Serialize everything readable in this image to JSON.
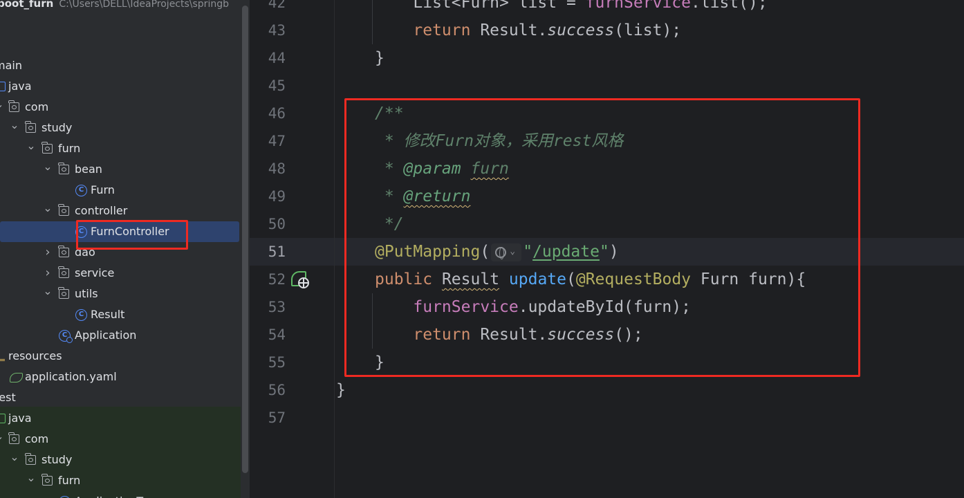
{
  "project": {
    "name": "boot_furn",
    "path": "C:\\Users\\DELL\\IdeaProjects\\springb"
  },
  "tree": [
    {
      "label": "main",
      "kind": "none",
      "indent": 0,
      "arrow": ""
    },
    {
      "label": "java",
      "kind": "src",
      "indent": 0,
      "arrow": ""
    },
    {
      "label": "com",
      "kind": "folder",
      "indent": 1,
      "arrow": "v"
    },
    {
      "label": "study",
      "kind": "folder",
      "indent": 2,
      "arrow": "v"
    },
    {
      "label": "furn",
      "kind": "folder",
      "indent": 3,
      "arrow": "v"
    },
    {
      "label": "bean",
      "kind": "folder",
      "indent": 4,
      "arrow": "v"
    },
    {
      "label": "Furn",
      "kind": "class",
      "indent": 5,
      "arrow": ""
    },
    {
      "label": "controller",
      "kind": "folder",
      "indent": 4,
      "arrow": "v"
    },
    {
      "label": "FurnController",
      "kind": "class",
      "indent": 5,
      "arrow": "",
      "selected": true
    },
    {
      "label": "dao",
      "kind": "folder",
      "indent": 4,
      "arrow": ">"
    },
    {
      "label": "service",
      "kind": "folder",
      "indent": 4,
      "arrow": ">"
    },
    {
      "label": "utils",
      "kind": "folder",
      "indent": 4,
      "arrow": "v"
    },
    {
      "label": "Result",
      "kind": "class",
      "indent": 5,
      "arrow": ""
    },
    {
      "label": "Application",
      "kind": "app",
      "indent": 4,
      "arrow": ""
    },
    {
      "label": "resources",
      "kind": "resources",
      "indent": 0,
      "arrow": ""
    },
    {
      "label": "application.yaml",
      "kind": "yaml",
      "indent": 1,
      "arrow": ""
    },
    {
      "label": "test",
      "kind": "none",
      "indent": 0,
      "arrow": ""
    },
    {
      "label": "java",
      "kind": "test",
      "indent": 0,
      "arrow": ""
    },
    {
      "label": "com",
      "kind": "folder",
      "indent": 1,
      "arrow": "v"
    },
    {
      "label": "study",
      "kind": "folder",
      "indent": 2,
      "arrow": "v"
    },
    {
      "label": "furn",
      "kind": "folder",
      "indent": 3,
      "arrow": "v"
    },
    {
      "label": "ApplicationT",
      "kind": "class",
      "indent": 4,
      "arrow": ""
    }
  ],
  "editor": {
    "current_line": 51,
    "lines": [
      {
        "n": "42",
        "tokens": [
          [
            "    List<Furn> list = ",
            ""
          ],
          [
            "furnService",
            "fld"
          ],
          [
            ".list();",
            ""
          ]
        ]
      },
      {
        "n": "43",
        "tokens": [
          [
            "    ",
            ""
          ],
          [
            "return",
            "kw"
          ],
          [
            " Result.",
            ""
          ],
          [
            "success",
            "it"
          ],
          [
            "(list);",
            ""
          ]
        ]
      },
      {
        "n": "44",
        "tokens": [
          [
            "}",
            ""
          ]
        ]
      },
      {
        "n": "45",
        "tokens": []
      },
      {
        "n": "46",
        "tokens": [
          [
            "/**",
            "doc"
          ]
        ]
      },
      {
        "n": "47",
        "tokens": [
          [
            " * 修改Furn对象，采用rest风格",
            "doc"
          ]
        ]
      },
      {
        "n": "48",
        "tokens": [
          [
            " * ",
            "doc"
          ],
          [
            "@param",
            "doctag"
          ],
          [
            " ",
            "doc"
          ],
          [
            "furn",
            "doc squig"
          ]
        ]
      },
      {
        "n": "49",
        "tokens": [
          [
            " * ",
            "doc"
          ],
          [
            "@return",
            "doctag squig"
          ]
        ]
      },
      {
        "n": "50",
        "tokens": [
          [
            " */",
            "doc"
          ]
        ]
      },
      {
        "n": "51",
        "tokens": [
          [
            "@PutMapping",
            "ann"
          ],
          [
            "(",
            ""
          ],
          [
            "__GLOBE__",
            ""
          ],
          [
            "\"",
            "str"
          ],
          [
            "/update",
            "str under"
          ],
          [
            "\"",
            "str"
          ],
          [
            ")",
            ""
          ]
        ]
      },
      {
        "n": "52",
        "tokens": [
          [
            "public",
            "kw"
          ],
          [
            " ",
            ""
          ],
          [
            "Result",
            "squig"
          ],
          [
            " ",
            ""
          ],
          [
            "update",
            "fn"
          ],
          [
            "(",
            ""
          ],
          [
            "@RequestBody",
            "ann"
          ],
          [
            " Furn furn){",
            ""
          ]
        ]
      },
      {
        "n": "53",
        "tokens": [
          [
            "    ",
            ""
          ],
          [
            "furnService",
            "fld"
          ],
          [
            ".updateById(furn);",
            ""
          ]
        ]
      },
      {
        "n": "54",
        "tokens": [
          [
            "    ",
            ""
          ],
          [
            "return",
            "kw"
          ],
          [
            " Result.",
            ""
          ],
          [
            "success",
            "it"
          ],
          [
            "();",
            ""
          ]
        ]
      },
      {
        "n": "55",
        "tokens": [
          [
            "}",
            ""
          ]
        ]
      },
      {
        "n": "56",
        "tokens": [
          [
            "}",
            ""
          ]
        ]
      },
      {
        "n": "57",
        "tokens": []
      }
    ]
  },
  "icons": {
    "class": "C",
    "app": "C",
    "inlay_chevron": "⌄"
  },
  "colors": {
    "annotation_red": "#ee2a22",
    "selection": "#2e436e",
    "keyword": "#cf8e6d",
    "field": "#c77dbb",
    "method": "#56a8f5",
    "annotation": "#b3ae60",
    "string": "#6aab73",
    "doc_comment": "#5f826b"
  }
}
